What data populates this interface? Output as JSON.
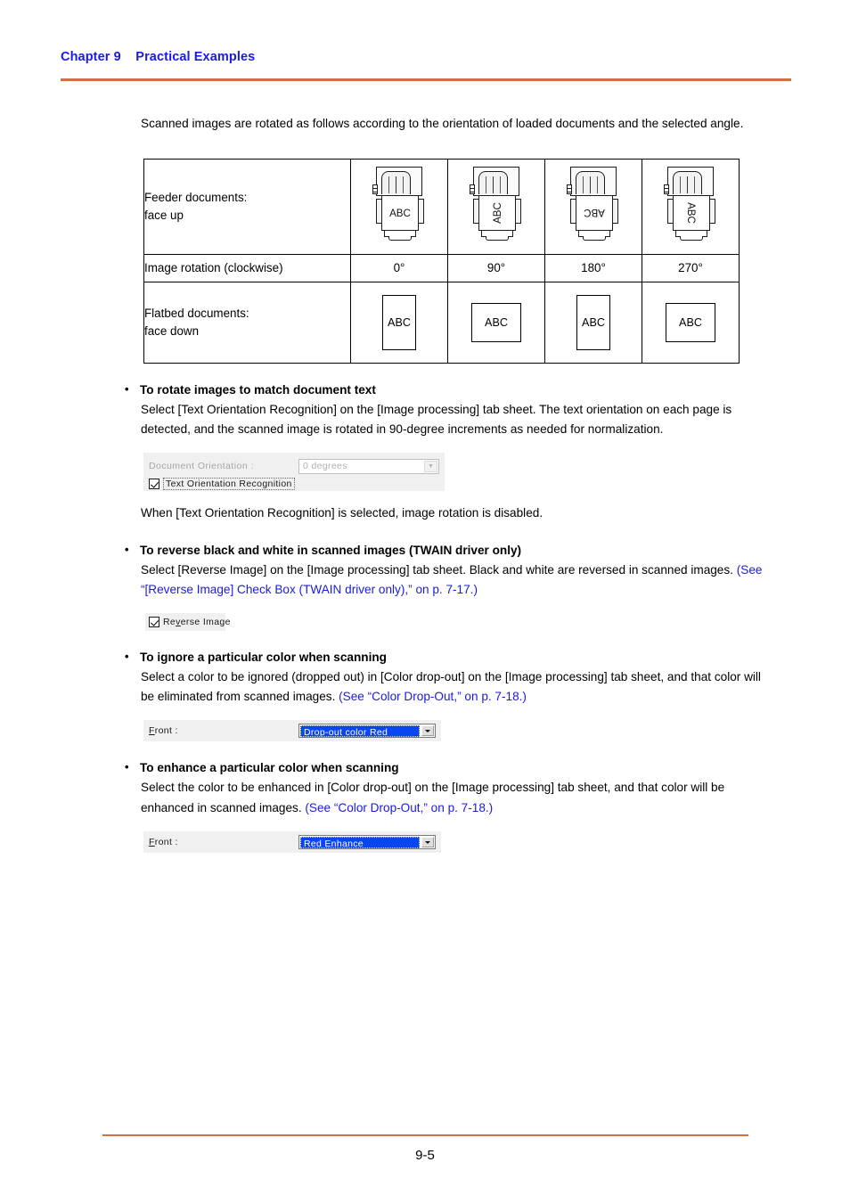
{
  "header": {
    "chapter": "Chapter 9",
    "title": "Practical Examples",
    "combined": "Chapter 9    Practical Examples"
  },
  "footer": {
    "page_number": "9-5"
  },
  "intro": {
    "paragraph": "Scanned images are rotated as follows according to the orientation of loaded documents and the selected angle."
  },
  "orientation_table": {
    "rows": {
      "feeder_label": "Feeder documents:\nface up",
      "rotation_label": "Image rotation (clockwise)",
      "flatbed_label": "Flatbed documents:\nface down"
    },
    "columns": [
      {
        "angle": "0°",
        "feeder_text": "ABC",
        "feeder_rotation": "0",
        "flatbed_text": "ABC",
        "flatbed_shape": "portrait"
      },
      {
        "angle": "90°",
        "feeder_text": "ABC",
        "feeder_rotation": "90",
        "flatbed_text": "ABC",
        "flatbed_shape": "landscape"
      },
      {
        "angle": "180°",
        "feeder_text": "ABC",
        "feeder_rotation": "180",
        "flatbed_text": "ABC",
        "flatbed_shape": "portrait"
      },
      {
        "angle": "270°",
        "feeder_text": "ABC",
        "feeder_rotation": "270",
        "flatbed_text": "ABC",
        "flatbed_shape": "landscape"
      }
    ]
  },
  "sections": [
    {
      "title": "To rotate images to match document text",
      "body_1": "Select [Text Orientation Recognition] on the [Image processing] tab sheet. The text orientation on each page is detected, and the scanned image is rotated in 90-degree increments as needed for normalization.",
      "note": "When [Text Orientation Recognition] is selected, image rotation is disabled."
    },
    {
      "title": "To reverse black and white in scanned images (TWAIN driver only)",
      "body_1": "Select [Reverse Image] on the [Image processing] tab sheet. Black and white are reversed in scanned images. ",
      "xref": "(See “[Reverse Image] Check Box (TWAIN driver only),” on p. 7-17.)"
    },
    {
      "title": "To ignore a particular color when scanning",
      "body_1": "Select a color to be ignored (dropped out) in [Color drop-out] on the [Image processing] tab sheet, and that color will be eliminated from scanned images. ",
      "xref": "(See “Color Drop-Out,” on p. 7-18.)"
    },
    {
      "title": "To enhance a particular color when scanning",
      "body_1": "Select the color to be enhanced in [Color drop-out] on the [Image processing] tab sheet, and that color will be enhanced in scanned images. ",
      "xref": "(See “Color Drop-Out,” on p. 7-18.)"
    }
  ],
  "widgets": {
    "orientation": {
      "label": "Document Orientation :",
      "dropdown_value": "0 degrees",
      "checkbox_label": "Text Orientation Recognition",
      "checkbox_checked": true
    },
    "reverse": {
      "checkbox_label": "Reverse Image",
      "checkbox_checked": true
    },
    "dropout": {
      "label": "Front :",
      "value": "Drop-out color Red"
    },
    "enhance": {
      "label": "Front :",
      "value": "Red Enhance"
    }
  },
  "colors": {
    "link": "#1a1ae6",
    "rule": "#d2713f",
    "selection": "#0a46f0"
  }
}
